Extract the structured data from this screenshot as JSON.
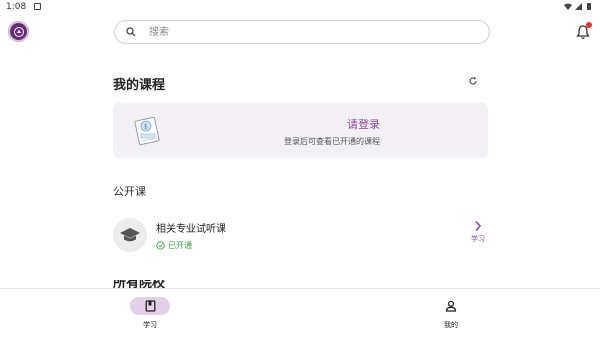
{
  "status_bar": {
    "time": "1:08"
  },
  "header": {
    "search_placeholder": "搜索"
  },
  "my_courses": {
    "title": "我的课程",
    "login_card": {
      "title": "请登录",
      "subtitle": "登录后可查看已开通的课程"
    }
  },
  "public_courses": {
    "title": "公开课",
    "items": [
      {
        "name": "相关专业试听课",
        "status": "已开通",
        "action_label": "学习"
      }
    ]
  },
  "next_section": {
    "title": "所有院校"
  },
  "bottom_nav": {
    "items": [
      {
        "label": "学习",
        "icon": "book-icon",
        "active": true
      },
      {
        "label": "我的",
        "icon": "person-icon",
        "active": false
      }
    ]
  },
  "colors": {
    "accent": "#8a4a99",
    "active_pill": "#e4d0e8",
    "card_bg": "#f3f0f6",
    "status_green": "#3aa347",
    "badge_red": "#e5322d"
  }
}
